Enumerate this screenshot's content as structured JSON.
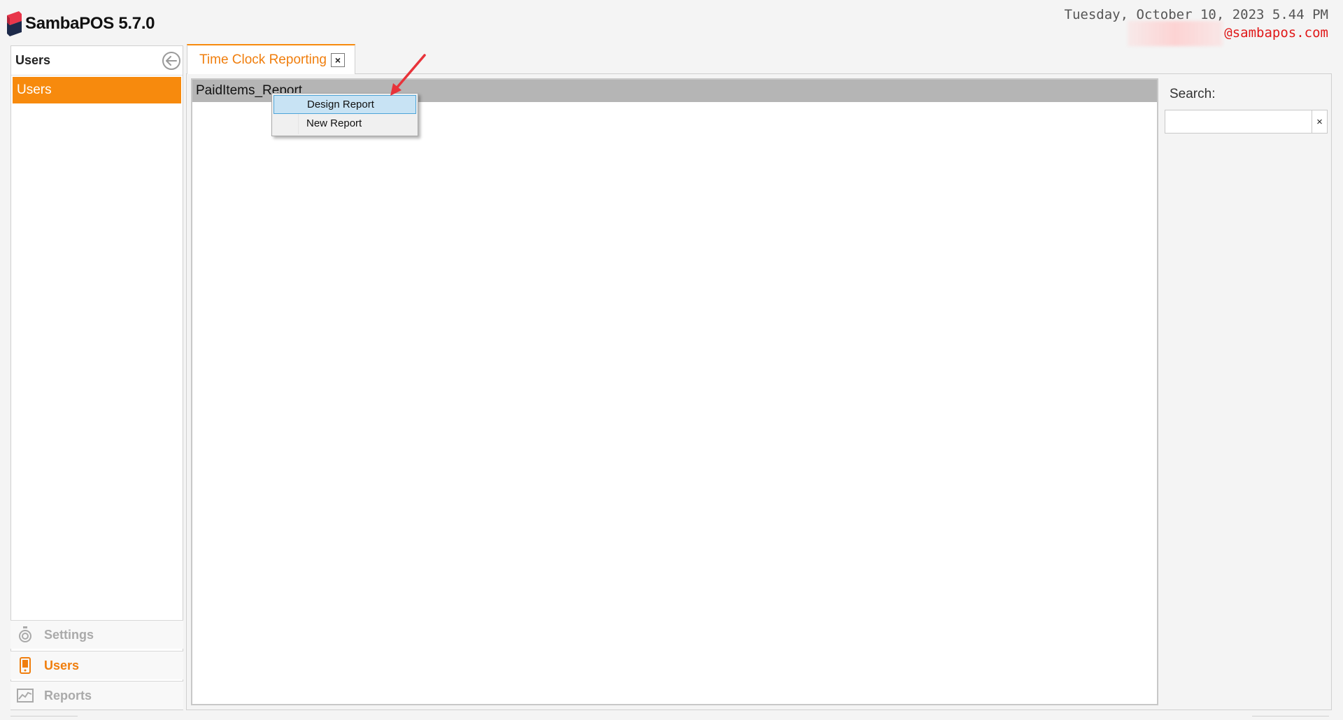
{
  "app": {
    "title": "SambaPOS 5.7.0",
    "datetime": "Tuesday, October 10, 2023 5.44 PM",
    "user_email": "@sambapos.com"
  },
  "left_panel": {
    "header": "Users",
    "items": [
      {
        "label": "Users",
        "selected": true
      }
    ]
  },
  "nav": {
    "settings": "Settings",
    "users": "Users",
    "reports": "Reports",
    "active": "users"
  },
  "tabs": [
    {
      "label": "Time Clock Reporting",
      "close": "×",
      "active": true
    }
  ],
  "reports": [
    {
      "name": "PaidItems_Report"
    }
  ],
  "context_menu": {
    "items": [
      {
        "label": "Design Report",
        "highlighted": true
      },
      {
        "label": "New Report",
        "highlighted": false
      }
    ]
  },
  "search": {
    "label": "Search:",
    "value": "",
    "placeholder": "",
    "clear": "×"
  },
  "colors": {
    "accent": "#f78a0d",
    "email": "#e01818",
    "annotation": "#e8333a"
  }
}
